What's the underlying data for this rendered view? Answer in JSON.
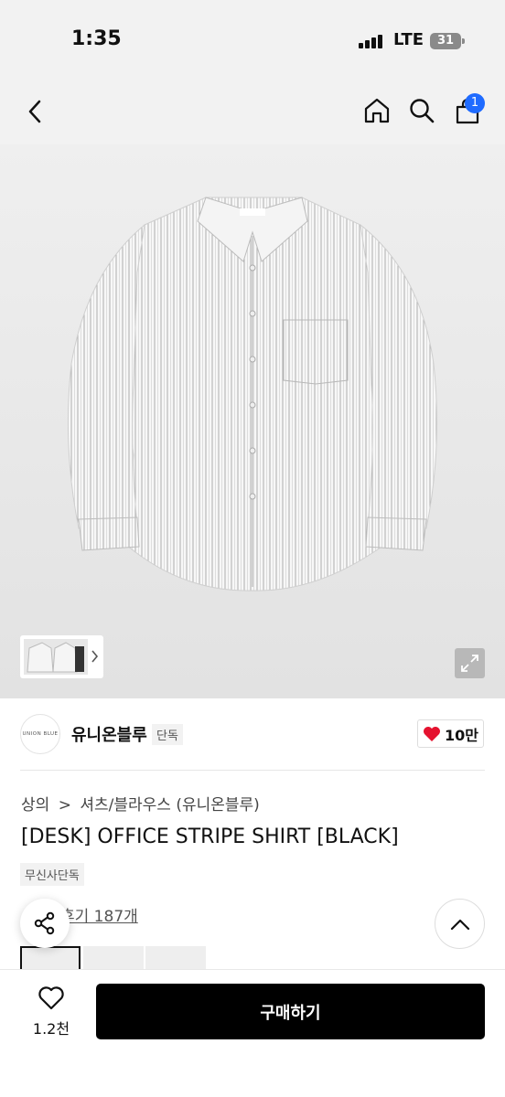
{
  "status": {
    "time": "1:35",
    "network": "LTE",
    "battery": "31"
  },
  "nav": {
    "cart_count": "1"
  },
  "brand": {
    "logo_text": "UNION BLUE",
    "name": "유니온블루",
    "tag": "단독",
    "likes": "10만"
  },
  "breadcrumb": {
    "category": "상의",
    "separator": ">",
    "subcategory": "셔츠/블라우스 (유니온블루)"
  },
  "product": {
    "title": "[DESK] OFFICE STRIPE SHIRT [BLACK]",
    "badge": "무신사단독",
    "reviews": "후기 187개"
  },
  "bottom": {
    "wish_count": "1.2천",
    "buy_label": "구매하기"
  },
  "colors": {
    "accent": "#1f6bff",
    "heart": "#e5122f",
    "buy_bg": "#000000"
  }
}
